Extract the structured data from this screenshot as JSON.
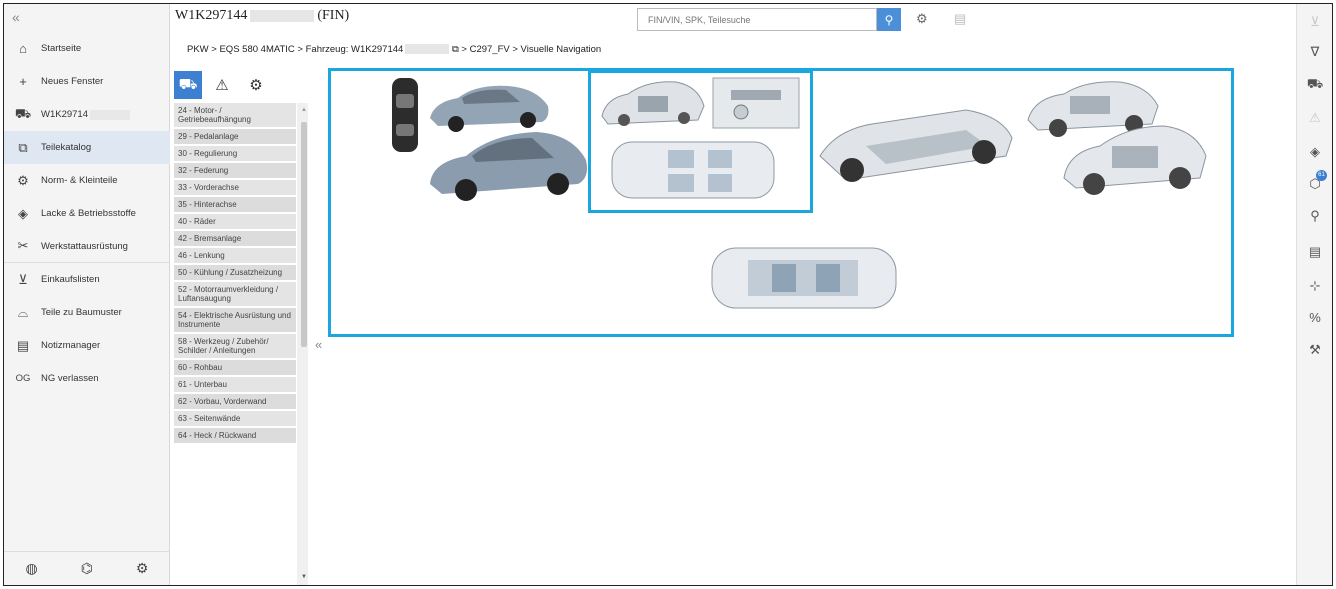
{
  "header": {
    "vin_prefix": "W1K297144",
    "vin_suffix": "(FIN)",
    "search_placeholder": "FIN/VIN, SPK, Teilesuche"
  },
  "breadcrumb": {
    "part1": "PKW > EQS 580 4MATIC > Fahrzeug: W1K297144",
    "part2": "> C297_FV",
    "part3": "> Visuelle Navigation"
  },
  "sidebar": {
    "collapse_glyph": "«",
    "items": [
      {
        "label": "Startseite",
        "icon": "home-icon"
      },
      {
        "label": "Neues Fenster",
        "icon": "plus-icon"
      },
      {
        "label": "W1K29714",
        "icon": "car-icon"
      },
      {
        "label": "Teilekatalog",
        "icon": "catalog-icon"
      },
      {
        "label": "Norm- & Kleinteile",
        "icon": "screws-icon"
      },
      {
        "label": "Lacke & Betriebsstoffe",
        "icon": "paint-icon"
      },
      {
        "label": "Werkstattausrüstung",
        "icon": "tools-icon"
      },
      {
        "label": "Einkaufslisten",
        "icon": "cart-icon"
      },
      {
        "label": "Teile zu Baumuster",
        "icon": "parts-icon"
      },
      {
        "label": "Notizmanager",
        "icon": "notes-icon"
      },
      {
        "label": "NG verlassen",
        "icon_text": "OG"
      }
    ]
  },
  "groups": [
    "24 - Motor- / Getriebeaufhängung",
    "29 - Pedalanlage",
    "30 - Regulierung",
    "32 - Federung",
    "33 - Vorderachse",
    "35 - Hinterachse",
    "40 - Räder",
    "42 - Bremsanlage",
    "46 - Lenkung",
    "50 - Kühlung / Zusatzheizung",
    "52 - Motorraumverkleidung / Luftansaugung",
    "54 - Elektrische Ausrüstung und Instrumente",
    "58 - Werkzeug / Zubehör/ Schilder / Anleitungen",
    "60 - Rohbau",
    "61 - Unterbau",
    "62 - Vorbau, Vorderwand",
    "63 - Seitenwände",
    "64 - Heck / Rückwand"
  ],
  "right_rail": {
    "badge_count": "61"
  },
  "colors": {
    "accent": "#3d7fd0",
    "highlight": "#1aa7e0"
  }
}
